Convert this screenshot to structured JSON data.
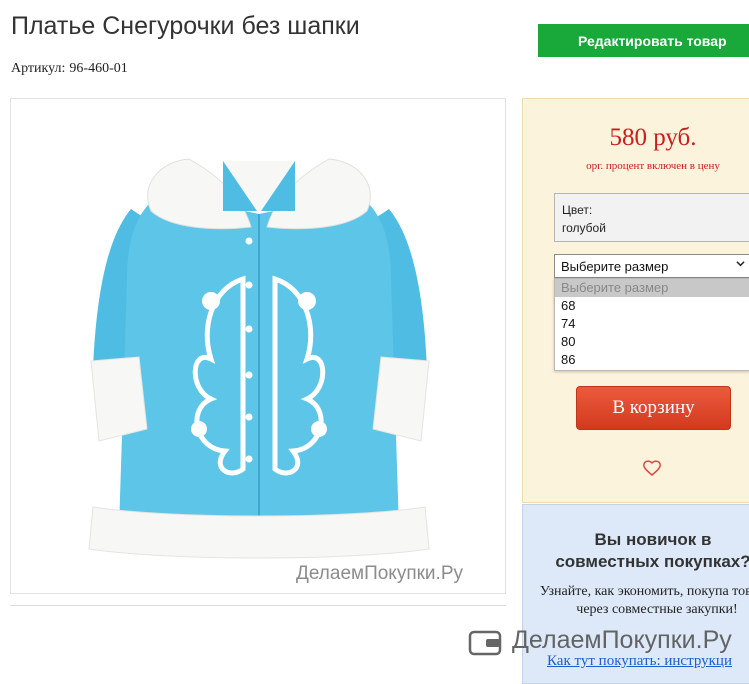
{
  "product": {
    "title": "Платье Снегурочки без шапки",
    "sku_label": "Артикул:",
    "sku_value": "96-460-01"
  },
  "toolbar": {
    "edit_label": "Редактировать товар"
  },
  "image": {
    "watermark": "ДелаемПокупки.Ру"
  },
  "pricing": {
    "price": "580 руб.",
    "note": "орг. процент включен в цену"
  },
  "color": {
    "label": "Цвет:",
    "value": "голубой"
  },
  "size_select": {
    "selected": "Выберите размер",
    "options": [
      "Выберите размер",
      "68",
      "74",
      "80",
      "86"
    ]
  },
  "cart": {
    "label": "В корзину"
  },
  "newbie": {
    "title": "Вы новичок в совместных покупках?",
    "text": "Узнайте, как экономить, покупа товары через совместные закупки!",
    "link": "Как тут покупать: инструкци"
  },
  "brand": {
    "name": "ДелаемПокупки.Ру"
  },
  "colors": {
    "accent_green": "#18a93a",
    "price_red": "#c91e1e",
    "cart_red": "#e04a2c",
    "panel_yellow": "#fcf3dc",
    "panel_blue": "#dde9f8",
    "coat_blue": "#5cc5e8"
  }
}
